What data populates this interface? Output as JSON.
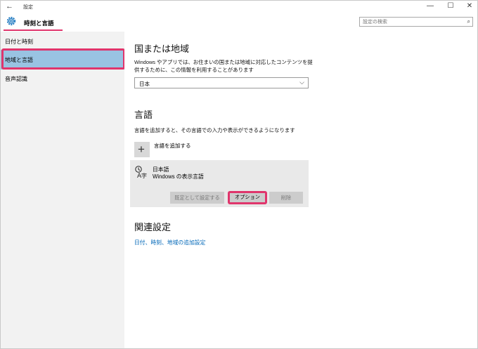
{
  "window": {
    "title": "設定",
    "back_icon": "←",
    "minimize": "—",
    "maximize": "☐",
    "close": "✕"
  },
  "header": {
    "page_title": "時刻と言語",
    "search_placeholder": "設定の検索"
  },
  "sidebar": {
    "items": [
      {
        "label": "日付と時刻"
      },
      {
        "label": "地域と言語",
        "selected": true
      },
      {
        "label": "音声認識"
      }
    ]
  },
  "main": {
    "region": {
      "heading": "国または地域",
      "description_line1": "Windows やアプリでは、お住まいの国または地域に対応したコンテンツを提",
      "description_line2": "供するために、この情報を利用することがあります",
      "selected": "日本"
    },
    "language": {
      "heading": "言語",
      "description": "言語を追加すると、その言語での入力や表示ができるようになります",
      "add_label": "言語を追加する",
      "entry": {
        "name": "日本語",
        "subtitle": "Windows の表示言語",
        "set_default_button": "既定として設定する",
        "options_button": "オプション",
        "remove_button": "削除"
      }
    },
    "related": {
      "heading": "関連設定",
      "link": "日付、時刻、地域の追加設定"
    }
  },
  "colors": {
    "accent": "#0067b8",
    "highlight": "#e0356c",
    "selected_nav": "#99c3e2"
  }
}
